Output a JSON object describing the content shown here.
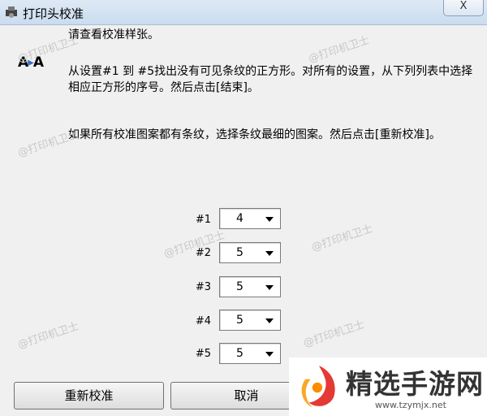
{
  "window": {
    "title": "打印头校准",
    "close_label": "X"
  },
  "instructions": {
    "line1": "请查看校准样张。",
    "line2": "从设置#1 到 #5找出没有可见条纹的正方形。对所有的设置，从下列列表中选择相应正方形的序号。然后点击[结束]。",
    "line3": "如果所有校准图案都有条纹，选择条纹最细的图案。然后点击[重新校准]。"
  },
  "settings": [
    {
      "label": "#1",
      "value": "4"
    },
    {
      "label": "#2",
      "value": "5"
    },
    {
      "label": "#3",
      "value": "5"
    },
    {
      "label": "#4",
      "value": "5"
    },
    {
      "label": "#5",
      "value": "5"
    }
  ],
  "buttons": {
    "recalibrate": "重新校准",
    "cancel": "取消"
  },
  "watermark": "@打印机卫士",
  "brand": {
    "name": "精选手游网",
    "url": "www.tzymjx.net"
  },
  "colors": {
    "titlebar": "#c9dcef",
    "window_bg": "#f0f0f0"
  }
}
